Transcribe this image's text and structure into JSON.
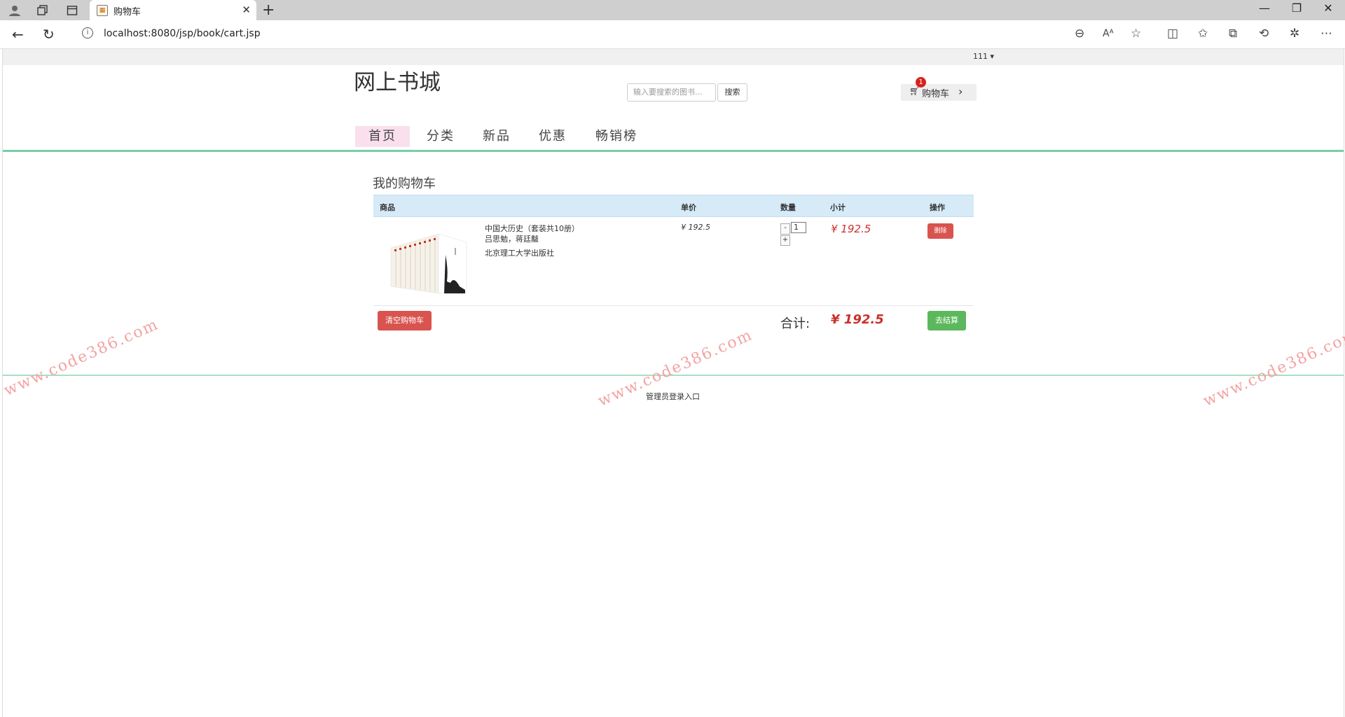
{
  "browser": {
    "tab_title": "购物车",
    "url": "localhost:8080/jsp/book/cart.jsp",
    "icons": [
      "profile-icon",
      "collections-icon",
      "tab-actions-icon",
      "back-icon",
      "refresh-icon",
      "info-icon",
      "zoom-out-icon",
      "read-aloud-icon",
      "favorite-icon",
      "split-screen-icon",
      "favorites-icon",
      "collections-icon",
      "history-icon",
      "extensions-icon",
      "more-icon"
    ]
  },
  "header": {
    "username": "111 ▾",
    "site_title": "网上书城",
    "search_placeholder": "输入要搜索的图书...",
    "search_button": "搜索",
    "cart_label": "购物车",
    "cart_count": "1"
  },
  "nav": {
    "items": [
      "首页",
      "分类",
      "新品",
      "优惠",
      "畅销榜"
    ],
    "active": "首页"
  },
  "cart": {
    "title": "我的购物车",
    "columns": [
      "商品",
      "单价",
      "数量",
      "小计",
      "操作"
    ],
    "rows": [
      {
        "name": "中国大历史（套装共10册）",
        "author": "吕思勉，蒋廷黻",
        "publisher": "北京理工大学出版社",
        "price": "¥ 192.5",
        "quantity": "1",
        "subtotal": "¥ 192.5",
        "delete_label": "删除"
      }
    ],
    "qty_minus": "-",
    "qty_plus": "+",
    "clear_label": "清空购物车",
    "total_label": "合计:",
    "total_value": "¥ 192.5",
    "checkout_label": "去结算"
  },
  "footer": {
    "admin_link": "管理员登录入口"
  },
  "watermark": "www.code386.com",
  "colors": {
    "accent_green": "#76cfa8",
    "danger": "#d9534f",
    "success": "#5cb85c",
    "price_red": "#c9302c",
    "table_header": "#d6eaf7",
    "nav_active": "#f9e0ec"
  }
}
